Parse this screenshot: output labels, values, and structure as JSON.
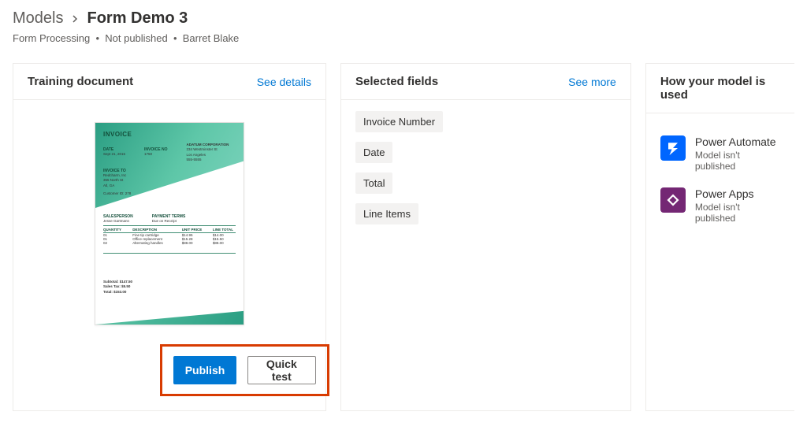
{
  "breadcrumb": {
    "parent": "Models",
    "current": "Form Demo 3"
  },
  "subheader": {
    "type": "Form Processing",
    "status": "Not published",
    "owner": "Barret Blake"
  },
  "training": {
    "title": "Training document",
    "link": "See details",
    "invoice": {
      "title": "INVOICE",
      "date_label": "DATE",
      "date_value": "Sept 21, 2015",
      "invoice_no_label": "INVOICE NO",
      "invoice_no_value": "1750",
      "company": "ADATUM CORPORATION",
      "addr1": "234 Westminster St",
      "addr2": "Los Angeles",
      "phone": "555-5555",
      "invoice_to_label": "INVOICE TO",
      "to_name": "Redcharm, Inc",
      "to_addr1": "355 North St",
      "to_addr2": "Atl, GA",
      "customer_id": "Customer ID: 278",
      "salesperson_label": "SALESPERSON",
      "salesperson": "Jesse Gartmann",
      "terms_label": "PAYMENT TERMS",
      "terms": "Due on Receipt",
      "qty_label": "QUANTITY",
      "desc_label": "DESCRIPTION",
      "unit_label": "UNIT PRICE",
      "line_label": "LINE TOTAL",
      "r1q": "01",
      "r1d": "Fine tip cartridge",
      "r1u": "$14.95",
      "r1t": "$14.00",
      "r2q": "01",
      "r2d": "Office replacement",
      "r2u": "$15.28",
      "r2t": "$15.50",
      "r3q": "02",
      "r3d": "Alternating handles",
      "r3u": "$88.00",
      "r3t": "$88.00",
      "subtotal": "Subtotal: $147.50",
      "tax": "Sales Tax: $5.50",
      "total": "Total: $153.00"
    }
  },
  "actions": {
    "publish": "Publish",
    "quick_test": "Quick test"
  },
  "fields": {
    "title": "Selected fields",
    "link": "See more",
    "items": [
      "Invoice Number",
      "Date",
      "Total",
      "Line Items"
    ]
  },
  "usage": {
    "title": "How your model is used",
    "items": [
      {
        "name": "Power Automate",
        "status": "Model isn't published",
        "icon": "power-automate-icon"
      },
      {
        "name": "Power Apps",
        "status": "Model isn't published",
        "icon": "power-apps-icon"
      }
    ]
  }
}
